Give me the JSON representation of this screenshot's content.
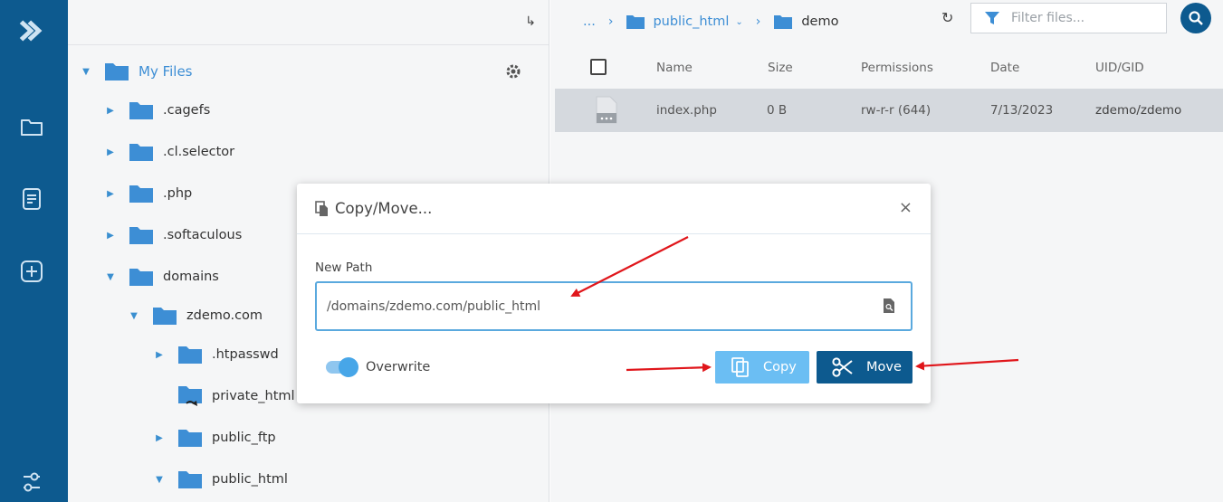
{
  "tree": {
    "root_label": "My Files",
    "nodes": [
      {
        "label": ".cagefs"
      },
      {
        "label": ".cl.selector"
      },
      {
        "label": ".php"
      },
      {
        "label": ".softaculous"
      },
      {
        "label": "domains"
      },
      {
        "label": "zdemo.com"
      },
      {
        "label": ".htpasswd"
      },
      {
        "label": "private_html"
      },
      {
        "label": "public_ftp"
      },
      {
        "label": "public_html"
      }
    ]
  },
  "breadcrumb": {
    "ellipsis": "...",
    "item1": "public_html",
    "item2": "demo"
  },
  "filter": {
    "placeholder": "Filter files..."
  },
  "table": {
    "headers": [
      "Name",
      "Size",
      "Permissions",
      "Date",
      "UID/GID"
    ],
    "rows": [
      {
        "name": "index.php",
        "size": "0 B",
        "permissions": "rw-r-r (644)",
        "date": "7/13/2023",
        "uid": "zdemo/zdemo"
      }
    ]
  },
  "modal": {
    "title": "Copy/Move...",
    "close_glyph": "×",
    "field_label": "New Path",
    "path_value": "/domains/zdemo.com/public_html",
    "overwrite_label": "Overwrite",
    "overwrite_on": true,
    "copy_label": "Copy",
    "move_label": "Move"
  },
  "colors": {
    "rail": "#0d5a8f",
    "accent": "#3d8ed5",
    "copy_button": "#6bbef3",
    "move_button": "#0d5a8f",
    "annotation_arrows": "#e0161b"
  }
}
